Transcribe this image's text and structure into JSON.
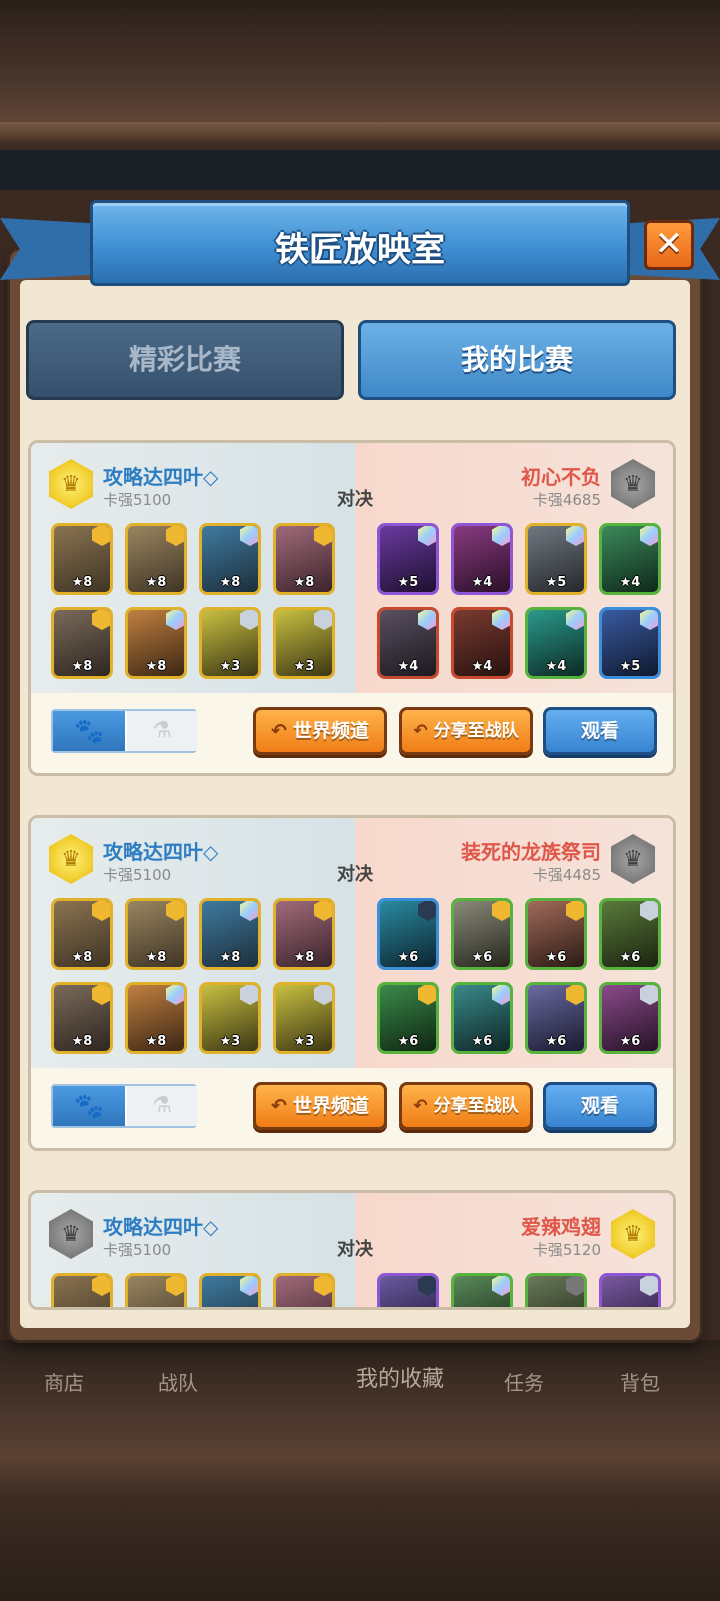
{
  "window": {
    "title": "铁匠放映室"
  },
  "tabs": [
    {
      "label": "精彩比赛",
      "active": false
    },
    {
      "label": "我的比赛",
      "active": true
    }
  ],
  "vs_label": "对决",
  "buttons": {
    "world_channel": "世界频道",
    "share_team": "分享至战队",
    "watch": "观看"
  },
  "matches": [
    {
      "left": {
        "name": "攻略达四叶◇",
        "score": "卡强5100",
        "badge": "gold"
      },
      "right": {
        "name": "初心不负",
        "score": "卡强4685",
        "badge": "gray"
      },
      "left_units": [
        "★8",
        "★8",
        "★8",
        "★8",
        "★8",
        "★8",
        "★3",
        "★3"
      ],
      "right_units": [
        "★5",
        "★4",
        "★5",
        "★4",
        "★4",
        "★4",
        "★4",
        "★5"
      ]
    },
    {
      "left": {
        "name": "攻略达四叶◇",
        "score": "卡强5100",
        "badge": "gold"
      },
      "right": {
        "name": "装死的龙族祭司",
        "score": "卡强4485",
        "badge": "gray"
      },
      "left_units": [
        "★8",
        "★8",
        "★8",
        "★8",
        "★8",
        "★8",
        "★3",
        "★3"
      ],
      "right_units": [
        "★6",
        "★6",
        "★6",
        "★6",
        "★6",
        "★6",
        "★6",
        "★6"
      ]
    },
    {
      "left": {
        "name": "攻略达四叶◇",
        "score": "卡强5100",
        "badge": "gray"
      },
      "right": {
        "name": "爱辣鸡翅",
        "score": "卡强5120",
        "badge": "gold"
      }
    }
  ],
  "bottom_nav": [
    "商店",
    "战队",
    "我的收藏",
    "任务",
    "背包"
  ],
  "colors": {
    "accent_blue": "#3f88c8",
    "accent_orange": "#f07d16",
    "left_name": "#2d7dc3",
    "right_name": "#e0574a"
  }
}
